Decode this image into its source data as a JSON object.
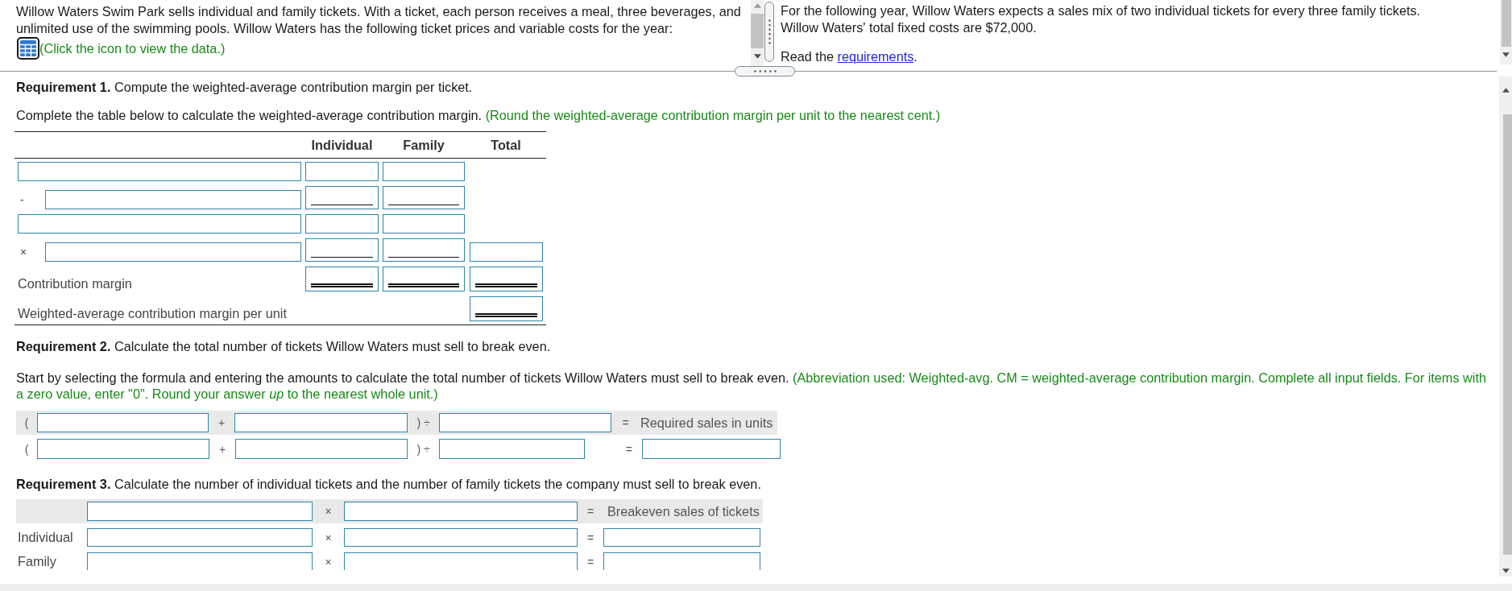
{
  "problem": {
    "text": "Willow Waters Swim Park sells individual and family tickets. With a ticket, each person receives a meal, three beverages, and unlimited use of the swimming pools. Willow Waters has the following ticket prices and variable costs for the year:",
    "data_hint": "(Click the icon to view the data.)"
  },
  "details": {
    "paragraphs": [
      "For the following year, Willow Waters expects a sales mix of two individual tickets for every three family tickets.",
      "Willow Waters' total fixed costs are $72,000."
    ],
    "read_prompt": {
      "before": "Read the",
      "link": "requirements",
      "after": "."
    }
  },
  "requirement_1": {
    "heading": "**Requirement 1.** Compute the weighted-average contribution margin per ticket.",
    "instruction": "Complete the table below to calculate the weighted-average contribution margin.",
    "hint": "(Round the weighted-average contribution margin per unit to the nearest cent.)",
    "table": {
      "columns": [
        "Individual",
        "Family",
        "Total"
      ],
      "rows": [
        {
          "label": {
            "kind": "field"
          },
          "cells": [
            {
              "kind": "field"
            },
            {
              "kind": "field"
            },
            {
              "kind": "blank"
            }
          ]
        },
        {
          "operator": "-",
          "label": {
            "kind": "field"
          },
          "cells": [
            {
              "kind": "subtotal"
            },
            {
              "kind": "subtotal"
            },
            {
              "kind": "blank"
            }
          ]
        },
        {
          "label": {
            "kind": "field"
          },
          "cells": [
            {
              "kind": "field"
            },
            {
              "kind": "field"
            },
            {
              "kind": "blank"
            }
          ]
        },
        {
          "operator": "×",
          "label": {
            "kind": "field"
          },
          "cells": [
            {
              "kind": "subtotal"
            },
            {
              "kind": "subtotal"
            },
            {
              "kind": "field"
            }
          ]
        },
        {
          "label": {
            "kind": "text",
            "text": "Contribution margin"
          },
          "cells": [
            {
              "kind": "total"
            },
            {
              "kind": "total"
            },
            {
              "kind": "total"
            }
          ]
        },
        {
          "label": {
            "kind": "text",
            "text": "Weighted-average contribution margin per unit"
          },
          "cells": [
            {
              "kind": "blank"
            },
            {
              "kind": "blank"
            },
            {
              "kind": "total"
            }
          ]
        }
      ]
    }
  },
  "requirement_2": {
    "heading": "**Requirement 2.** Calculate the total number of tickets Willow Waters must sell to break even.",
    "instruction": "Start by selecting the formula and entering the amounts to calculate the total number of tickets Willow Waters must sell to break even.",
    "hint": "(Abbreviation used: Weighted-avg. CM = weighted-average contribution margin. Complete all input fields. For items with a zero value, enter \"0\". Round your answer *up* to the nearest whole unit.)",
    "formula": {
      "rows": [
        {
          "kind": "header",
          "parts": [
            {
              "kind": "symbol",
              "text": "("
            },
            {
              "kind": "field"
            },
            {
              "kind": "symbol",
              "text": "+"
            },
            {
              "kind": "field"
            },
            {
              "kind": "symbol",
              "text": ") ÷"
            },
            {
              "kind": "field"
            },
            {
              "kind": "symbol",
              "text": "="
            },
            {
              "kind": "label",
              "text": "Required sales in units"
            }
          ]
        },
        {
          "kind": "answer",
          "parts": [
            {
              "kind": "symbol",
              "text": "("
            },
            {
              "kind": "field"
            },
            {
              "kind": "symbol",
              "text": "+"
            },
            {
              "kind": "field"
            },
            {
              "kind": "symbol",
              "text": ") ÷"
            },
            {
              "kind": "field"
            },
            {
              "kind": "symbol",
              "text": "="
            },
            {
              "kind": "field"
            }
          ]
        }
      ]
    }
  },
  "requirement_3": {
    "heading": "**Requirement 3.** Calculate the number of individual tickets and the number of family tickets the company must sell to break even.",
    "table": {
      "rows": [
        {
          "kind": "header",
          "parts": [
            {
              "kind": "field"
            },
            {
              "kind": "symbol",
              "text": "×"
            },
            {
              "kind": "field"
            },
            {
              "kind": "symbol",
              "text": "="
            },
            {
              "kind": "label",
              "text": "Breakeven sales of tickets"
            }
          ]
        },
        {
          "kind": "answer",
          "label": "Individual",
          "parts": [
            {
              "kind": "field"
            },
            {
              "kind": "symbol",
              "text": "×"
            },
            {
              "kind": "field"
            },
            {
              "kind": "symbol",
              "text": "="
            },
            {
              "kind": "field"
            }
          ]
        },
        {
          "kind": "answer",
          "label": "Family",
          "parts": [
            {
              "kind": "field"
            },
            {
              "kind": "symbol",
              "text": "×"
            },
            {
              "kind": "field"
            },
            {
              "kind": "symbol",
              "text": "="
            },
            {
              "kind": "field"
            }
          ]
        }
      ]
    }
  }
}
